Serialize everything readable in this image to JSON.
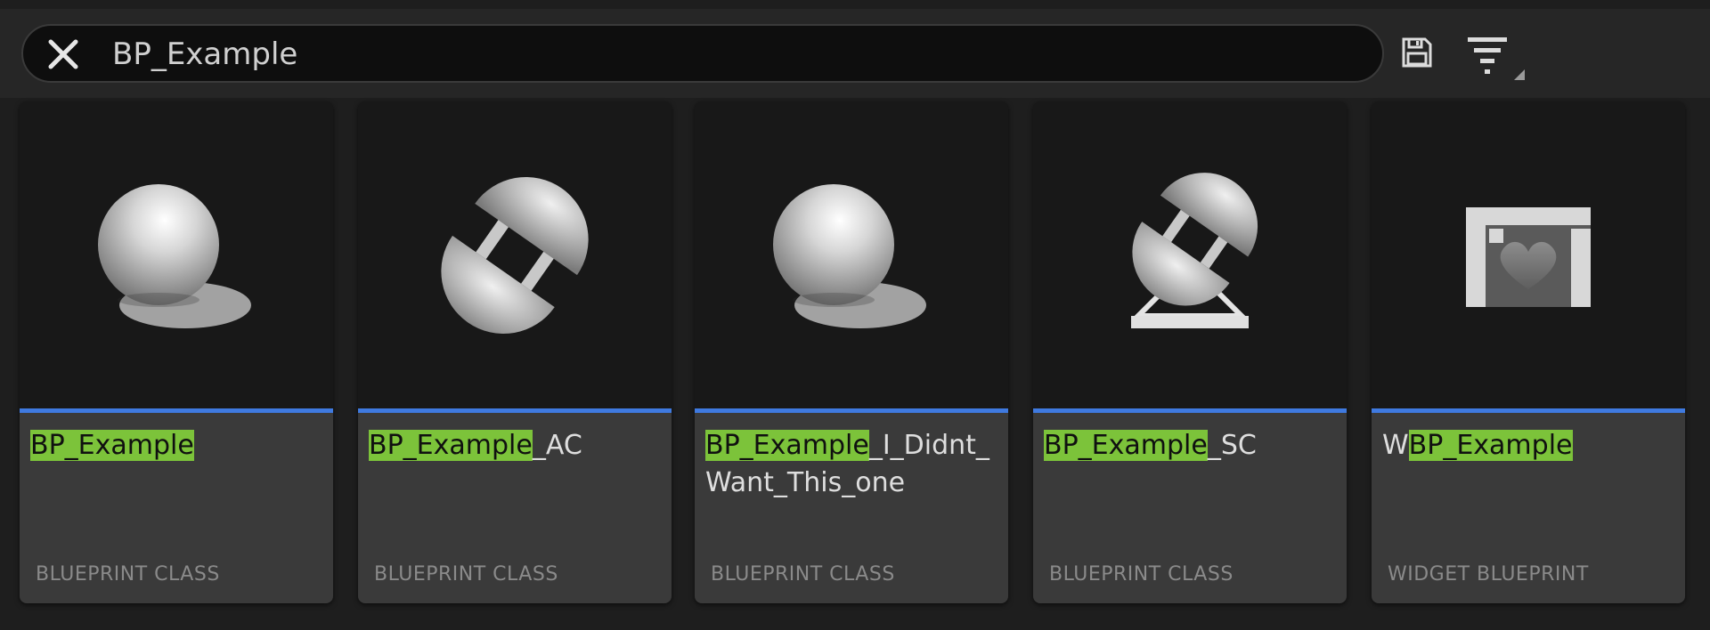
{
  "search": {
    "value": "BP_Example",
    "clear_icon": "close-icon"
  },
  "toolbar": {
    "save_icon": "save-icon",
    "filter_icon": "filter-icon"
  },
  "colors": {
    "highlight": "#7cc33a",
    "accent": "#3f7ae0",
    "card_bg": "#3a3a3a"
  },
  "assets": [
    {
      "prefix": "",
      "match": "BP_Example",
      "suffix": "",
      "type": "BLUEPRINT CLASS",
      "icon": "actor-icon"
    },
    {
      "prefix": "",
      "match": "BP_Example",
      "suffix": "_AC",
      "type": "BLUEPRINT CLASS",
      "icon": "actor-component-icon"
    },
    {
      "prefix": "",
      "match": "BP_Example",
      "suffix": "_I_Didnt_Want_This_one",
      "type": "BLUEPRINT CLASS",
      "icon": "actor-icon"
    },
    {
      "prefix": "",
      "match": "BP_Example",
      "suffix": "_SC",
      "type": "BLUEPRINT CLASS",
      "icon": "scene-component-icon"
    },
    {
      "prefix": "W",
      "match": "BP_Example",
      "suffix": "",
      "type": "WIDGET BLUEPRINT",
      "icon": "widget-blueprint-icon"
    }
  ]
}
